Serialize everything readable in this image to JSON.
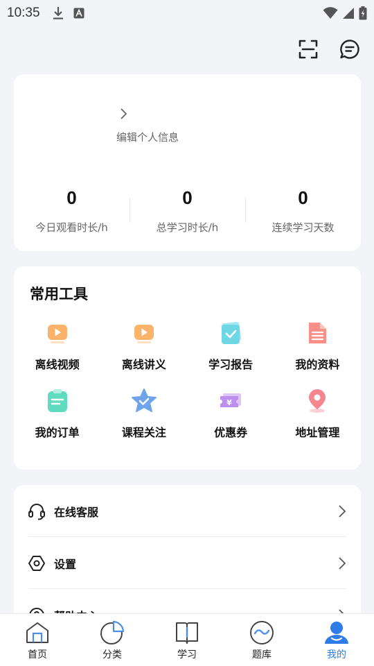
{
  "status_bar": {
    "time": "10:35"
  },
  "profile": {
    "edit_label": "编辑个人信息",
    "stats": [
      {
        "value": "0",
        "label": "今日观看时长/h"
      },
      {
        "value": "0",
        "label": "总学习时长/h"
      },
      {
        "value": "0",
        "label": "连续学习天数"
      }
    ]
  },
  "tools": {
    "title": "常用工具",
    "items": [
      {
        "label": "离线视频",
        "icon": "play-video-icon"
      },
      {
        "label": "离线讲义",
        "icon": "play-handout-icon"
      },
      {
        "label": "学习报告",
        "icon": "report-check-icon"
      },
      {
        "label": "我的资料",
        "icon": "document-icon"
      },
      {
        "label": "我的订单",
        "icon": "order-clipboard-icon"
      },
      {
        "label": "课程关注",
        "icon": "star-check-icon"
      },
      {
        "label": "优惠券",
        "icon": "coupon-icon"
      },
      {
        "label": "地址管理",
        "icon": "location-pin-icon"
      }
    ]
  },
  "menu": {
    "items": [
      {
        "label": "在线客服",
        "icon": "headset-icon"
      },
      {
        "label": "设置",
        "icon": "settings-hexagon-icon"
      },
      {
        "label": "帮助中心",
        "icon": "help-icon"
      }
    ]
  },
  "tabbar": {
    "items": [
      {
        "label": "首页",
        "icon": "home-icon"
      },
      {
        "label": "分类",
        "icon": "category-pie-icon"
      },
      {
        "label": "学习",
        "icon": "book-icon"
      },
      {
        "label": "题库",
        "icon": "question-bank-icon"
      },
      {
        "label": "我的",
        "icon": "user-icon",
        "active": true
      }
    ]
  },
  "colors": {
    "accent": "#2f7be8",
    "background": "#f2f4f8",
    "card": "#ffffff"
  }
}
